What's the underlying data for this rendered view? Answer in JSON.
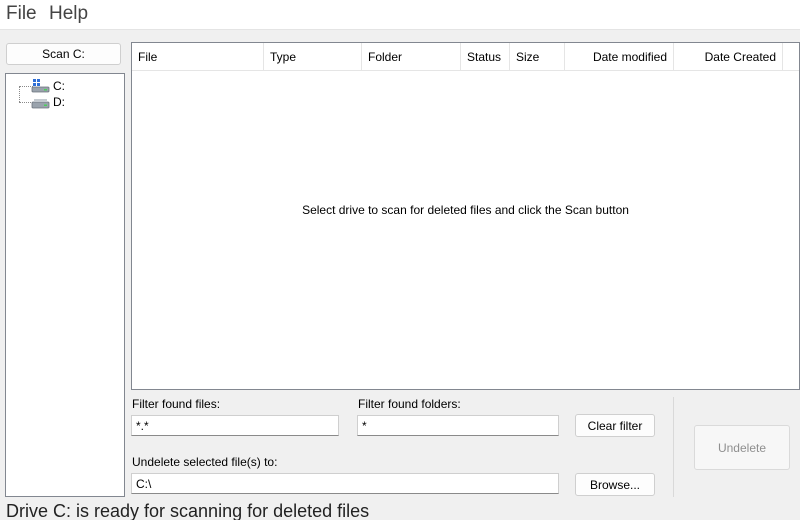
{
  "menu": {
    "file": "File",
    "help": "Help"
  },
  "scan_button": "Scan C:",
  "drives": [
    {
      "label": "C:",
      "icon": "windows-drive-icon"
    },
    {
      "label": "D:",
      "icon": "drive-icon"
    }
  ],
  "list": {
    "columns": [
      "File",
      "Type",
      "Folder",
      "Status",
      "Size",
      "Date modified",
      "Date Created"
    ],
    "empty_message": "Select drive to scan for deleted files and click the Scan button"
  },
  "filters": {
    "files_label": "Filter found files:",
    "files_value": "*.*",
    "folders_label": "Filter found folders:",
    "folders_value": "*",
    "clear_button": "Clear filter"
  },
  "undelete": {
    "label": "Undelete selected file(s) to:",
    "path": "C:\\",
    "browse_button": "Browse...",
    "undelete_button": "Undelete"
  },
  "status": "Drive C: is ready for scanning for deleted files",
  "colors": {
    "windows_blue": "#2f6fd6",
    "border": "#828790"
  }
}
